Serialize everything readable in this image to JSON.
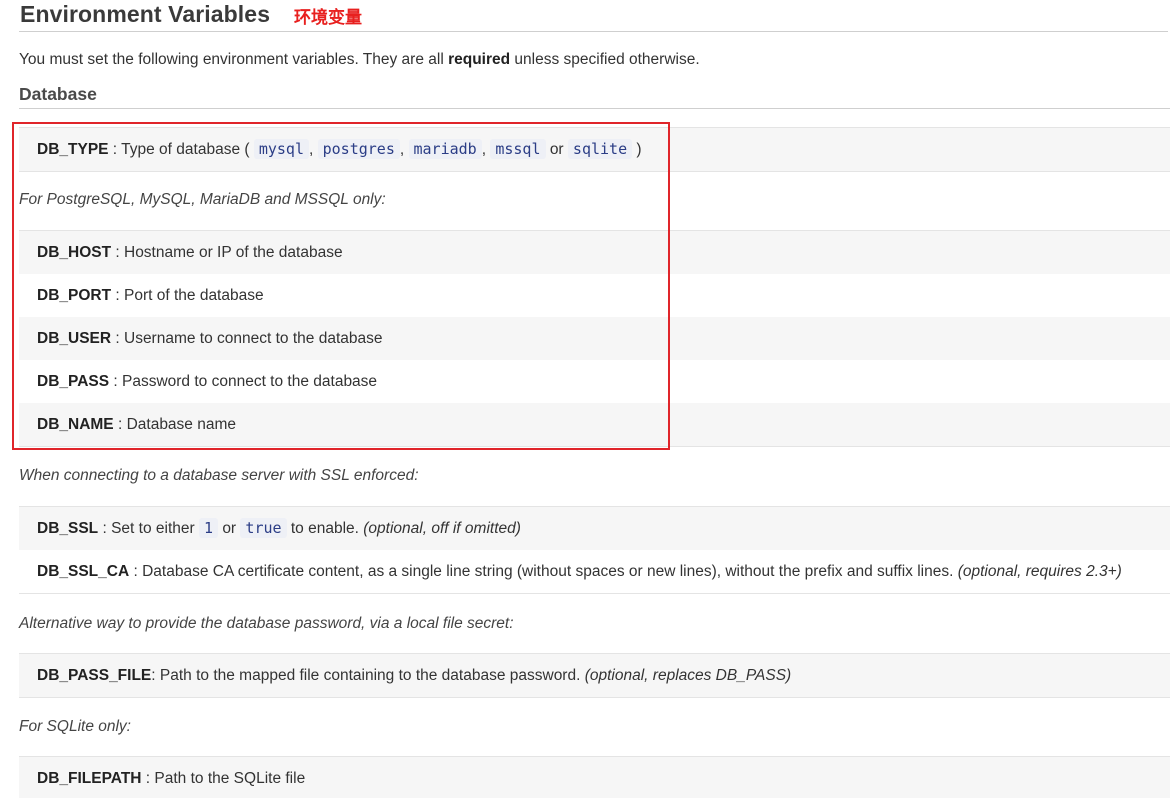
{
  "heading": {
    "title": "Environment Variables",
    "annotation": "环境变量"
  },
  "intro": {
    "before": "You must set the following environment variables. They are all ",
    "strong": "required",
    "after": " unless specified otherwise."
  },
  "section": {
    "title": "Database"
  },
  "db_type": {
    "name": "DB_TYPE",
    "desc": " : Type of database (",
    "options": [
      "mysql",
      "postgres",
      "mariadb",
      "mssql",
      "sqlite"
    ],
    "comma": ",",
    "or": "or",
    "close": ")"
  },
  "note_pg": "For PostgreSQL, MySQL, MariaDB and MSSQL only:",
  "pg_vars": [
    {
      "name": "DB_HOST",
      "desc": " : Hostname or IP of the database"
    },
    {
      "name": "DB_PORT",
      "desc": " : Port of the database"
    },
    {
      "name": "DB_USER",
      "desc": " : Username to connect to the database"
    },
    {
      "name": "DB_PASS",
      "desc": " : Password to connect to the database"
    },
    {
      "name": "DB_NAME",
      "desc": " : Database name"
    }
  ],
  "note_ssl": "When connecting to a database server with SSL enforced:",
  "ssl_vars": {
    "db_ssl": {
      "name": "DB_SSL",
      "desc_a": " : Set to either ",
      "val1": "1",
      "or": "or",
      "val2": "true",
      "desc_b": " to enable. ",
      "optional": "(optional, off if omitted)"
    },
    "db_ssl_ca": {
      "name": "DB_SSL_CA",
      "desc": " : Database CA certificate content, as a single line string (without spaces or new lines), without the prefix and suffix lines. ",
      "optional": "(optional, requires 2.3+)"
    }
  },
  "note_file": "Alternative way to provide the database password, via a local file secret:",
  "pass_file": {
    "name": "DB_PASS_FILE",
    "desc": ": Path to the mapped file containing to the database password. ",
    "optional": "(optional, replaces DB_PASS)"
  },
  "note_sqlite": "For SQLite only:",
  "filepath": {
    "name": "DB_FILEPATH",
    "desc": " : Path to the SQLite file"
  },
  "colors": {
    "highlight_border": "#e0252a",
    "annotation": "#e8201f",
    "code_text": "#2b3d86",
    "code_bg": "#eef0f6",
    "row_alt_bg": "#f6f6f6"
  }
}
